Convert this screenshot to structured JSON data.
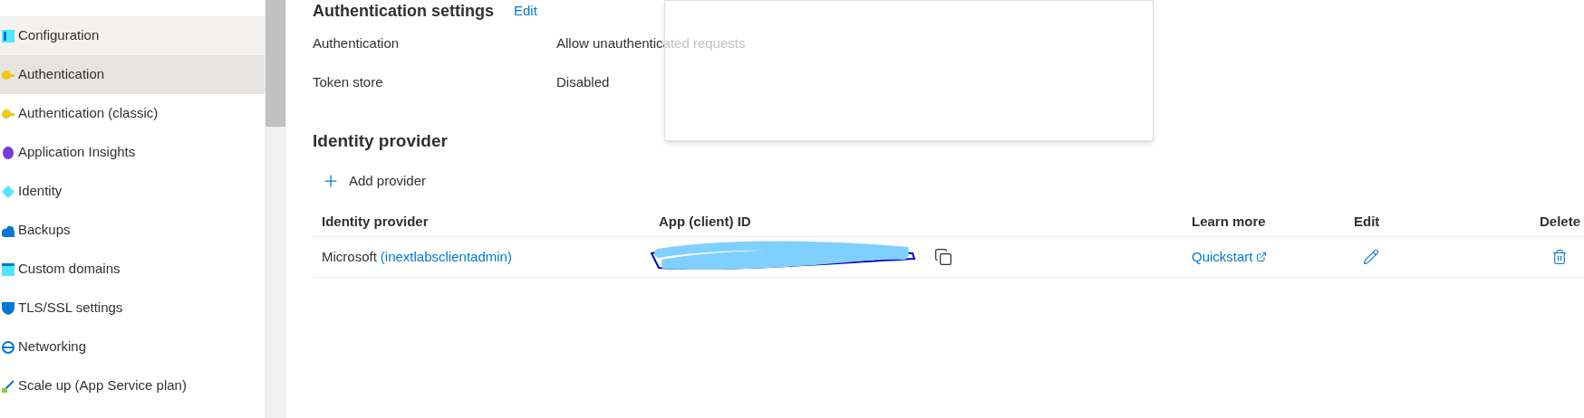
{
  "sidebar": {
    "items": [
      {
        "label": "Configuration",
        "selected": false,
        "hovered": true
      },
      {
        "label": "Authentication",
        "selected": true,
        "hovered": false
      },
      {
        "label": "Authentication (classic)",
        "selected": false,
        "hovered": false
      },
      {
        "label": "Application Insights",
        "selected": false,
        "hovered": false
      },
      {
        "label": "Identity",
        "selected": false,
        "hovered": false
      },
      {
        "label": "Backups",
        "selected": false,
        "hovered": false
      },
      {
        "label": "Custom domains",
        "selected": false,
        "hovered": false
      },
      {
        "label": "TLS/SSL settings",
        "selected": false,
        "hovered": false
      },
      {
        "label": "Networking",
        "selected": false,
        "hovered": false
      },
      {
        "label": "Scale up (App Service plan)",
        "selected": false,
        "hovered": false
      }
    ]
  },
  "auth_settings": {
    "title": "Authentication settings",
    "edit_link": "Edit",
    "rows": [
      {
        "label": "Authentication",
        "value": "Allow unauthenticated requests"
      },
      {
        "label": "Token store",
        "value": "Disabled"
      }
    ]
  },
  "identity_provider": {
    "title": "Identity provider",
    "add_button": "Add provider",
    "table": {
      "columns": [
        "Identity provider",
        "App (client) ID",
        "Learn more",
        "Edit",
        "Delete"
      ],
      "rows": [
        {
          "provider": "Microsoft",
          "app_name": "(inextlabsclientadmin)",
          "link": "Quickstart"
        }
      ]
    }
  }
}
